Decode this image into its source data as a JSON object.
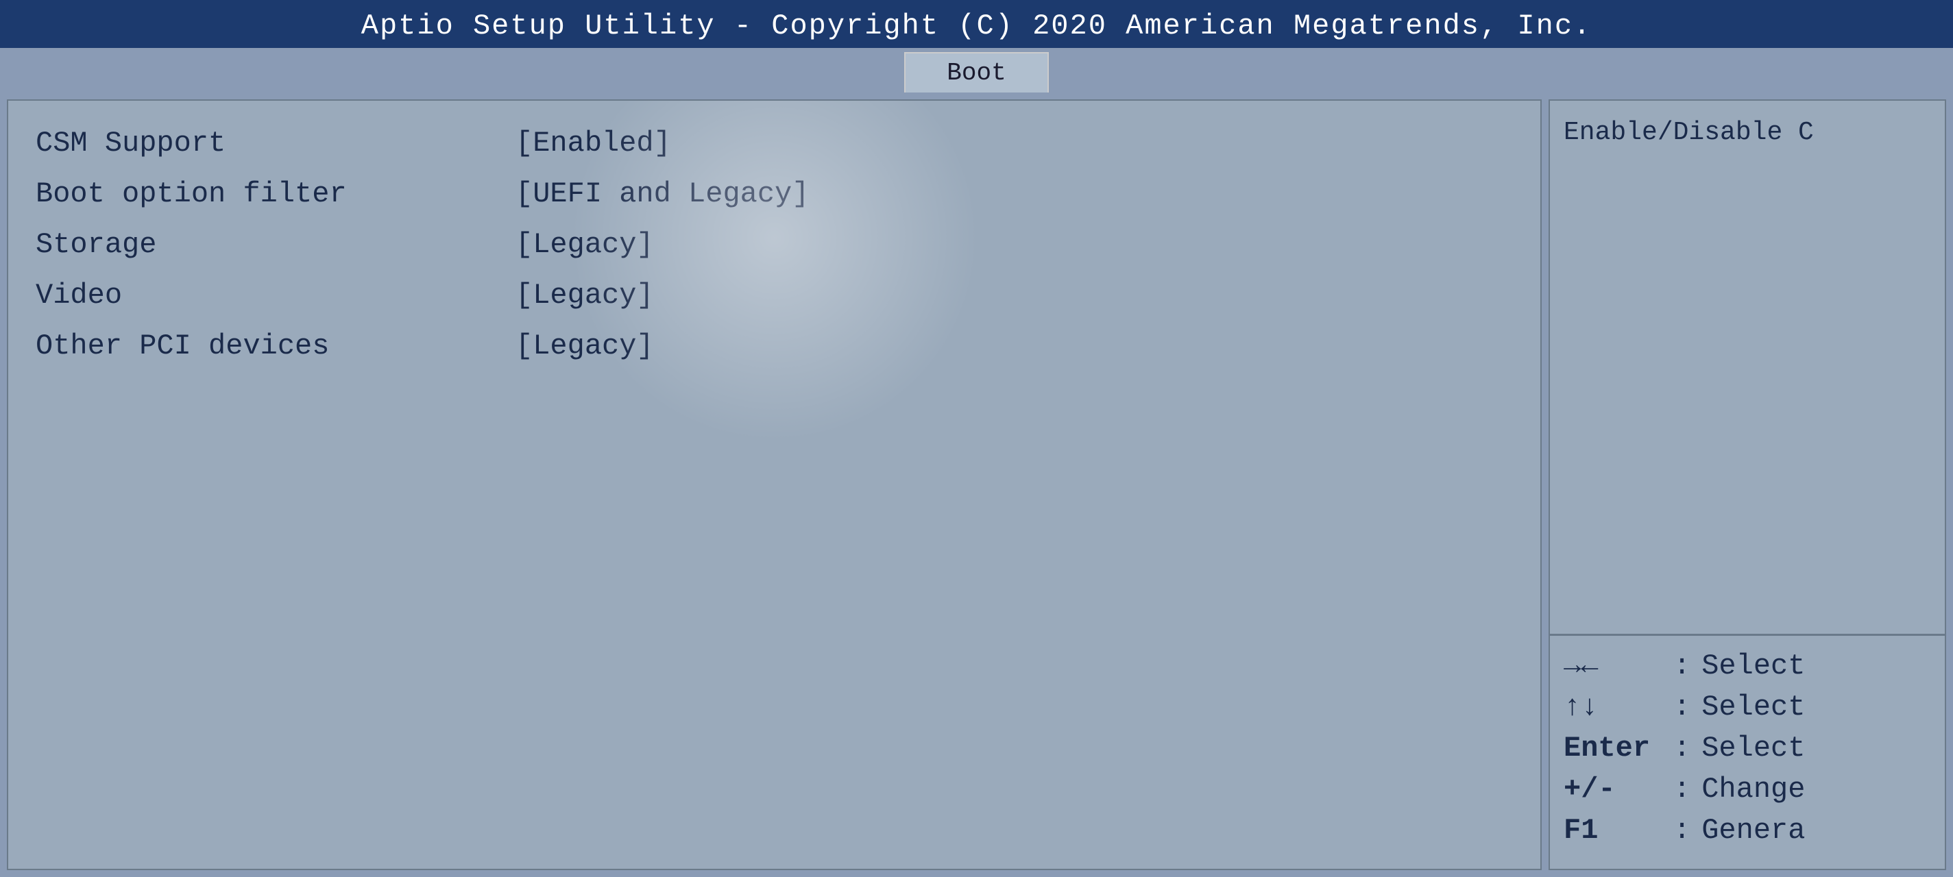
{
  "title_bar": {
    "text": "Aptio Setup Utility - Copyright (C) 2020 American Megatrends, Inc."
  },
  "tab": {
    "label": "Boot"
  },
  "settings": [
    {
      "name": "CSM Support",
      "value": "[Enabled]"
    },
    {
      "name": "Boot option filter",
      "value": "[UEFI and Legacy]"
    },
    {
      "name": "Storage",
      "value": "[Legacy]"
    },
    {
      "name": "Video",
      "value": "[Legacy]"
    },
    {
      "name": "Other PCI devices",
      "value": "[Legacy]"
    }
  ],
  "right_panel": {
    "description": "Enable/Disable C",
    "key_help": [
      {
        "symbol": "→←",
        "colon": ":",
        "desc": "Select"
      },
      {
        "symbol": "↑↓",
        "colon": ":",
        "desc": "Select"
      },
      {
        "symbol": "Enter",
        "colon": ":",
        "desc": "Select"
      },
      {
        "symbol": "+/-",
        "colon": ":",
        "desc": "Change"
      },
      {
        "symbol": "F1",
        "colon": ":",
        "desc": "Genera"
      }
    ]
  }
}
